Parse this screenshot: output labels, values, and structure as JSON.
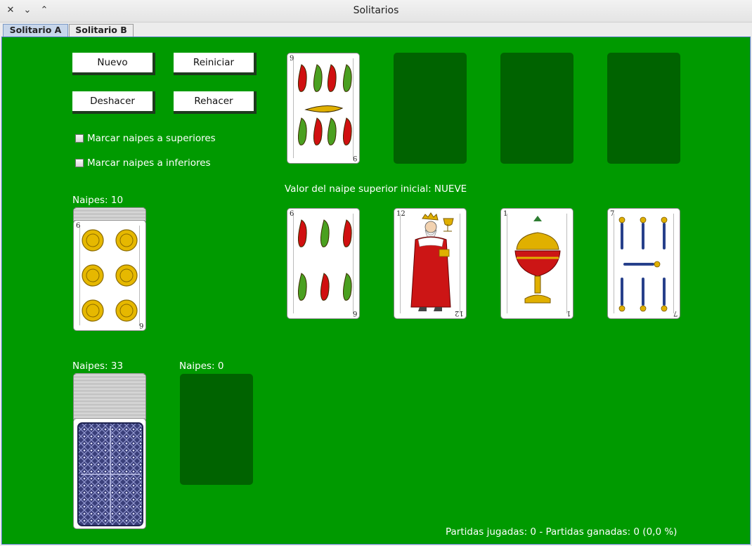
{
  "window": {
    "title": "Solitarios"
  },
  "tabs": [
    {
      "label": "Solitario A",
      "active": true
    },
    {
      "label": "Solitario B",
      "active": false
    }
  ],
  "buttons": {
    "nuevo": "Nuevo",
    "reiniciar": "Reiniciar",
    "deshacer": "Deshacer",
    "rehacer": "Rehacer"
  },
  "options": {
    "mark_upper": "Marcar naipes a superiores",
    "mark_lower": "Marcar naipes a inferiores"
  },
  "info": {
    "initial_value": "Valor del naipe superior inicial: NUEVE"
  },
  "reserve": {
    "label": "Naipes: 10",
    "top_card": {
      "rank": "6",
      "suit": "oros"
    }
  },
  "stock": {
    "label": "Naipes: 33",
    "face": "down"
  },
  "waste": {
    "label": "Naipes: 0"
  },
  "foundations": [
    {
      "rank": "9",
      "suit": "bastos"
    },
    {
      "rank": "",
      "suit": ""
    },
    {
      "rank": "",
      "suit": ""
    },
    {
      "rank": "",
      "suit": ""
    }
  ],
  "tableau": [
    {
      "rank": "6",
      "suit": "bastos"
    },
    {
      "rank": "12",
      "suit": "copas"
    },
    {
      "rank": "1",
      "suit": "copas"
    },
    {
      "rank": "7",
      "suit": "espadas"
    }
  ],
  "status": {
    "text": "Partidas jugadas: 0 - Partidas ganadas: 0 (0,0 %)"
  },
  "colors": {
    "felt": "#009a00",
    "empty_slot": "#006300",
    "button_shadow": "#1e3a1e"
  }
}
